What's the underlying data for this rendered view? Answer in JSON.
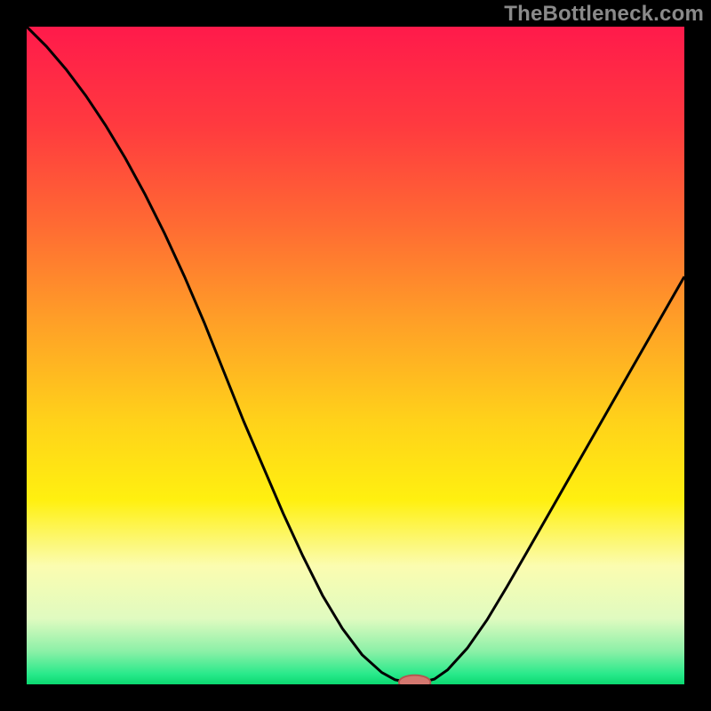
{
  "watermark": "TheBottleneck.com",
  "chart_data": {
    "type": "line",
    "title": "",
    "xlabel": "",
    "ylabel": "",
    "xlim": [
      0,
      100
    ],
    "ylim": [
      0,
      100
    ],
    "grid": false,
    "background_gradient": [
      {
        "pos": 0.0,
        "color": "#ff1a4b"
      },
      {
        "pos": 0.15,
        "color": "#ff3a3f"
      },
      {
        "pos": 0.3,
        "color": "#ff6a33"
      },
      {
        "pos": 0.45,
        "color": "#ffa027"
      },
      {
        "pos": 0.6,
        "color": "#ffd21a"
      },
      {
        "pos": 0.72,
        "color": "#fff010"
      },
      {
        "pos": 0.82,
        "color": "#fbfcb0"
      },
      {
        "pos": 0.9,
        "color": "#e0fbc0"
      },
      {
        "pos": 0.95,
        "color": "#8bf0a7"
      },
      {
        "pos": 0.985,
        "color": "#27e98a"
      },
      {
        "pos": 1.0,
        "color": "#0bd870"
      }
    ],
    "series": [
      {
        "name": "bottleneck-curve",
        "color": "#000000",
        "width": 3,
        "x": [
          0,
          3,
          6,
          9,
          12,
          15,
          18,
          21,
          24,
          27,
          30,
          33,
          36,
          39,
          42,
          45,
          48,
          51,
          54,
          56,
          58,
          60,
          62,
          64,
          67,
          70,
          73,
          76,
          80,
          84,
          88,
          92,
          96,
          100
        ],
        "y": [
          100,
          97,
          93.5,
          89.5,
          85,
          80,
          74.5,
          68.5,
          62,
          55,
          47.5,
          40,
          33,
          26,
          19.5,
          13.5,
          8.5,
          4.5,
          1.8,
          0.7,
          0.3,
          0.3,
          0.8,
          2.2,
          5.5,
          9.8,
          14.8,
          20,
          27,
          34,
          41,
          48,
          55,
          62
        ]
      }
    ],
    "marker": {
      "name": "optimum-marker",
      "cx": 59,
      "cy": 0.3,
      "rx": 2.4,
      "ry": 1.1,
      "fill": "#d4776f",
      "stroke": "#b3564f"
    }
  }
}
